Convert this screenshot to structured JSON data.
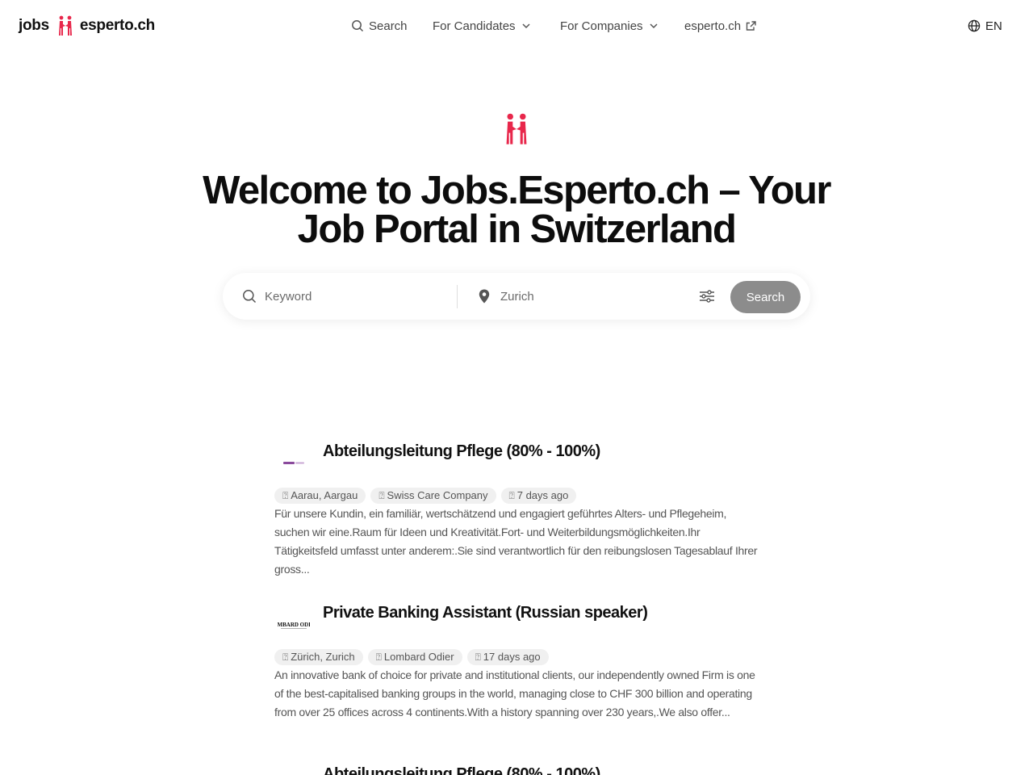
{
  "brand": {
    "left": "jobs",
    "right": "esperto.ch",
    "accent": "#e8274b"
  },
  "nav": {
    "search": "Search",
    "candidates": "For Candidates",
    "companies": "For Companies",
    "external": "esperto.ch",
    "language": "EN"
  },
  "hero": {
    "title": "Welcome to Jobs.Esperto.ch – Your Job Portal in Switzerland"
  },
  "search": {
    "keyword_placeholder": "Keyword",
    "location_placeholder": "Zurich",
    "button": "Search",
    "button_color": "#8c8c8c"
  },
  "jobs": [
    {
      "title": "Abteilungsleitung Pflege (80% - 100%)",
      "location": "Aarau, Aargau",
      "company": "Swiss Care Company",
      "posted": "7 days ago",
      "logo": "swiss-care-logo",
      "description": "Für unsere Kundin, ein familiär, wertschätzend und engagiert geführtes Alters- und Pflegeheim, suchen wir eine.Raum für Ideen und Kreativität.Fort- und Weiterbildungsmöglichkeiten.Ihr Tätigkeitsfeld umfasst unter anderem:.Sie sind verantwortlich für den reibungslosen Tagesablauf Ihrer gross..."
    },
    {
      "title": "Private Banking Assistant (Russian speaker)",
      "location": "Zürich, Zurich",
      "company": "Lombard Odier",
      "posted": "17 days ago",
      "logo": "lombard-odier-logo",
      "logo_text": "LOMBARD ODIER",
      "description": "An innovative bank of choice for private and institutional clients, our independently owned Firm is one of the best-capitalised banking groups in the world, managing close to CHF 300 billion and operating from over 25 offices across 4 continents.With a history spanning over 230 years,.We also offer..."
    },
    {
      "title": "Abteilungsleitung Pflege (80% - 100%)"
    }
  ],
  "icons": {
    "tag_placeholder": "⍰"
  }
}
